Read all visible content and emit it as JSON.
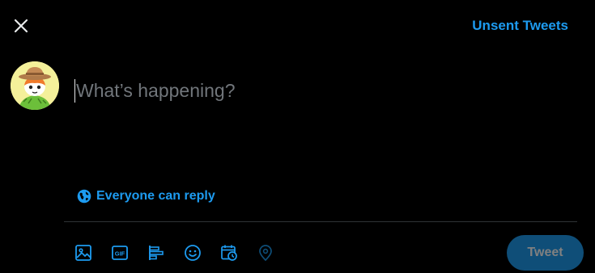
{
  "header": {
    "close_icon": "close-icon",
    "unsent_tweets_label": "Unsent Tweets"
  },
  "composer": {
    "avatar_alt": "profile-avatar",
    "placeholder": "What’s happening?",
    "value": ""
  },
  "reply_setting": {
    "icon": "globe-icon",
    "label": "Everyone can reply"
  },
  "toolbar": {
    "items": [
      {
        "icon": "media-icon"
      },
      {
        "icon": "gif-icon"
      },
      {
        "icon": "poll-icon"
      },
      {
        "icon": "emoji-icon"
      },
      {
        "icon": "schedule-icon"
      },
      {
        "icon": "location-icon"
      }
    ],
    "tweet_label": "Tweet"
  },
  "colors": {
    "background": "#000000",
    "accent": "#1d9bf0",
    "tweet_button_disabled": "#0f4e78",
    "divider": "#2f3336",
    "placeholder": "#71767b"
  }
}
